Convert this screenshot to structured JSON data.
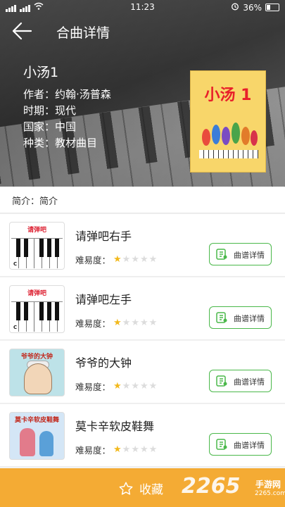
{
  "status_bar": {
    "time": "11:23",
    "battery": "36%"
  },
  "nav": {
    "title": "合曲详情"
  },
  "song": {
    "title": "小汤1",
    "author": "作者：约翰·汤普森",
    "period": "时期：现代",
    "country": "国家：中国",
    "category": "种类：教材曲目",
    "cover_text": "小汤 1"
  },
  "intro": "简介：简介",
  "items": [
    {
      "title": "请弹吧右手",
      "difficulty_label": "难易度：",
      "difficulty": 1,
      "thumb_label": "请弹吧",
      "button": "曲谱详情"
    },
    {
      "title": "请弹吧左手",
      "difficulty_label": "难易度：",
      "difficulty": 1,
      "thumb_label": "请弹吧",
      "button": "曲谱详情"
    },
    {
      "title": "爷爷的大钟",
      "difficulty_label": "难易度：",
      "difficulty": 1,
      "thumb_label": "爷爷的大钟",
      "button": "曲谱详情"
    },
    {
      "title": "莫卡辛软皮鞋舞",
      "difficulty_label": "难易度：",
      "difficulty": 1,
      "thumb_label": "莫卡辛软皮鞋舞",
      "button": "曲谱详情"
    }
  ],
  "bottom": {
    "favorite": "收藏"
  },
  "watermark": {
    "main": "2265",
    "sub": "手游网",
    "domain": "2265.com"
  },
  "colors": {
    "accent_green": "#4ab84a",
    "bottom_bar": "#f4ab34",
    "star_on": "#f2b91c"
  }
}
